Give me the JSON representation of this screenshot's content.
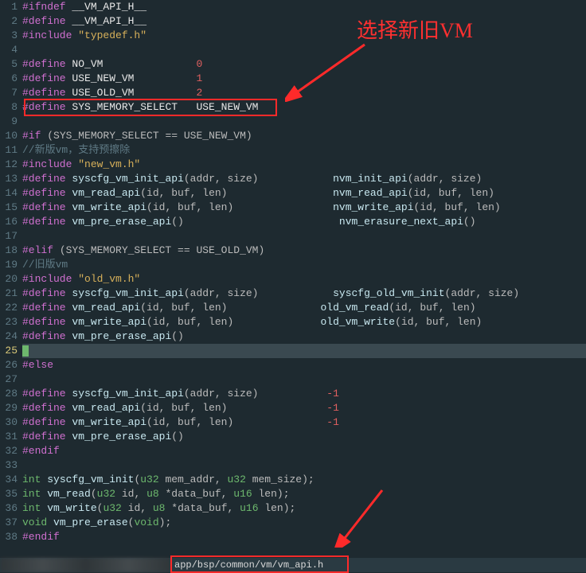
{
  "annotation_text": "选择新旧VM",
  "status_path": "app/bsp/common/vm/vm_api.h",
  "current_line": 25,
  "code": [
    {
      "n": 1,
      "t": [
        [
          "k-pp",
          "#ifndef "
        ],
        [
          "k-mac",
          "__VM_API_H__"
        ]
      ]
    },
    {
      "n": 2,
      "t": [
        [
          "k-pp",
          "#define "
        ],
        [
          "k-mac",
          "__VM_API_H__"
        ]
      ]
    },
    {
      "n": 3,
      "t": [
        [
          "k-pp",
          "#include "
        ],
        [
          "k-str",
          "\"typedef.h\""
        ]
      ]
    },
    {
      "n": 4,
      "t": []
    },
    {
      "n": 5,
      "t": [
        [
          "k-pp",
          "#define "
        ],
        [
          "k-mac",
          "NO_VM               "
        ],
        [
          "k-num",
          "0"
        ]
      ]
    },
    {
      "n": 6,
      "t": [
        [
          "k-pp",
          "#define "
        ],
        [
          "k-mac",
          "USE_NEW_VM          "
        ],
        [
          "k-num",
          "1"
        ]
      ]
    },
    {
      "n": 7,
      "t": [
        [
          "k-pp",
          "#define "
        ],
        [
          "k-mac",
          "USE_OLD_VM          "
        ],
        [
          "k-num",
          "2"
        ]
      ]
    },
    {
      "n": 8,
      "t": [
        [
          "k-pp",
          "#define "
        ],
        [
          "k-mac",
          "SYS_MEMORY_SELECT   USE_NEW_VM"
        ]
      ]
    },
    {
      "n": 9,
      "t": []
    },
    {
      "n": 10,
      "t": [
        [
          "k-pp",
          "#if "
        ],
        [
          "k-def",
          "(SYS_MEMORY_SELECT "
        ],
        [
          "k-def",
          "=="
        ],
        [
          "k-def",
          " USE_NEW_VM)"
        ]
      ]
    },
    {
      "n": 11,
      "t": [
        [
          "k-cmt",
          "//新版vm，支持预擦除"
        ]
      ]
    },
    {
      "n": 12,
      "t": [
        [
          "k-pp",
          "#include "
        ],
        [
          "k-str",
          "\"new_vm.h\""
        ]
      ]
    },
    {
      "n": 13,
      "t": [
        [
          "k-pp",
          "#define "
        ],
        [
          "k-fn",
          "syscfg_vm_init_api"
        ],
        [
          "k-def",
          "(addr, size)            "
        ],
        [
          "k-fn",
          "nvm_init_api"
        ],
        [
          "k-def",
          "(addr, size)"
        ]
      ]
    },
    {
      "n": 14,
      "t": [
        [
          "k-pp",
          "#define "
        ],
        [
          "k-fn",
          "vm_read_api"
        ],
        [
          "k-def",
          "(id, buf, len)                 "
        ],
        [
          "k-fn",
          "nvm_read_api"
        ],
        [
          "k-def",
          "(id, buf, len)"
        ]
      ]
    },
    {
      "n": 15,
      "t": [
        [
          "k-pp",
          "#define "
        ],
        [
          "k-fn",
          "vm_write_api"
        ],
        [
          "k-def",
          "(id, buf, len)                "
        ],
        [
          "k-fn",
          "nvm_write_api"
        ],
        [
          "k-def",
          "(id, buf, len)"
        ]
      ]
    },
    {
      "n": 16,
      "t": [
        [
          "k-pp",
          "#define "
        ],
        [
          "k-fn",
          "vm_pre_erase_api"
        ],
        [
          "k-def",
          "()                         "
        ],
        [
          "k-fn",
          "nvm_erasure_next_api"
        ],
        [
          "k-def",
          "()"
        ]
      ]
    },
    {
      "n": 17,
      "t": []
    },
    {
      "n": 18,
      "t": [
        [
          "k-pp",
          "#elif "
        ],
        [
          "k-def",
          "(SYS_MEMORY_SELECT "
        ],
        [
          "k-def",
          "=="
        ],
        [
          "k-def",
          " USE_OLD_VM)"
        ]
      ]
    },
    {
      "n": 19,
      "t": [
        [
          "k-cmt",
          "//旧版vm"
        ]
      ]
    },
    {
      "n": 20,
      "t": [
        [
          "k-pp",
          "#include "
        ],
        [
          "k-str",
          "\"old_vm.h\""
        ]
      ]
    },
    {
      "n": 21,
      "t": [
        [
          "k-pp",
          "#define "
        ],
        [
          "k-fn",
          "syscfg_vm_init_api"
        ],
        [
          "k-def",
          "(addr, size)            "
        ],
        [
          "k-fn",
          "syscfg_old_vm_init"
        ],
        [
          "k-def",
          "(addr, size)"
        ]
      ]
    },
    {
      "n": 22,
      "t": [
        [
          "k-pp",
          "#define "
        ],
        [
          "k-fn",
          "vm_read_api"
        ],
        [
          "k-def",
          "(id, buf, len)               "
        ],
        [
          "k-fn",
          "old_vm_read"
        ],
        [
          "k-def",
          "(id, buf, len)"
        ]
      ]
    },
    {
      "n": 23,
      "t": [
        [
          "k-pp",
          "#define "
        ],
        [
          "k-fn",
          "vm_write_api"
        ],
        [
          "k-def",
          "(id, buf, len)              "
        ],
        [
          "k-fn",
          "old_vm_write"
        ],
        [
          "k-def",
          "(id, buf, len)"
        ]
      ]
    },
    {
      "n": 24,
      "t": [
        [
          "k-pp",
          "#define "
        ],
        [
          "k-fn",
          "vm_pre_erase_api"
        ],
        [
          "k-def",
          "()"
        ]
      ]
    },
    {
      "n": 25,
      "t": []
    },
    {
      "n": 26,
      "t": [
        [
          "k-pp",
          "#else"
        ]
      ]
    },
    {
      "n": 27,
      "t": []
    },
    {
      "n": 28,
      "t": [
        [
          "k-pp",
          "#define "
        ],
        [
          "k-fn",
          "syscfg_vm_init_api"
        ],
        [
          "k-def",
          "(addr, size)           "
        ],
        [
          "k-num",
          "-1"
        ]
      ]
    },
    {
      "n": 29,
      "t": [
        [
          "k-pp",
          "#define "
        ],
        [
          "k-fn",
          "vm_read_api"
        ],
        [
          "k-def",
          "(id, buf, len)                "
        ],
        [
          "k-num",
          "-1"
        ]
      ]
    },
    {
      "n": 30,
      "t": [
        [
          "k-pp",
          "#define "
        ],
        [
          "k-fn",
          "vm_write_api"
        ],
        [
          "k-def",
          "(id, buf, len)               "
        ],
        [
          "k-num",
          "-1"
        ]
      ]
    },
    {
      "n": 31,
      "t": [
        [
          "k-pp",
          "#define "
        ],
        [
          "k-fn",
          "vm_pre_erase_api"
        ],
        [
          "k-def",
          "()"
        ]
      ]
    },
    {
      "n": 32,
      "t": [
        [
          "k-pp",
          "#endif"
        ]
      ]
    },
    {
      "n": 33,
      "t": []
    },
    {
      "n": 34,
      "t": [
        [
          "k-type",
          "int "
        ],
        [
          "k-fn",
          "syscfg_vm_init"
        ],
        [
          "k-def",
          "("
        ],
        [
          "k-type",
          "u32"
        ],
        [
          "k-def",
          " mem_addr, "
        ],
        [
          "k-type",
          "u32"
        ],
        [
          "k-def",
          " mem_size);"
        ]
      ]
    },
    {
      "n": 35,
      "t": [
        [
          "k-type",
          "int "
        ],
        [
          "k-fn",
          "vm_read"
        ],
        [
          "k-def",
          "("
        ],
        [
          "k-type",
          "u32"
        ],
        [
          "k-def",
          " id, "
        ],
        [
          "k-type",
          "u8"
        ],
        [
          "k-def",
          " *data_buf, "
        ],
        [
          "k-type",
          "u16"
        ],
        [
          "k-def",
          " len);"
        ]
      ]
    },
    {
      "n": 36,
      "t": [
        [
          "k-type",
          "int "
        ],
        [
          "k-fn",
          "vm_write"
        ],
        [
          "k-def",
          "("
        ],
        [
          "k-type",
          "u32"
        ],
        [
          "k-def",
          " id, "
        ],
        [
          "k-type",
          "u8"
        ],
        [
          "k-def",
          " *data_buf, "
        ],
        [
          "k-type",
          "u16"
        ],
        [
          "k-def",
          " len);"
        ]
      ]
    },
    {
      "n": 37,
      "t": [
        [
          "k-type",
          "void "
        ],
        [
          "k-fn",
          "vm_pre_erase"
        ],
        [
          "k-def",
          "("
        ],
        [
          "k-type",
          "void"
        ],
        [
          "k-def",
          ");"
        ]
      ]
    },
    {
      "n": 38,
      "t": [
        [
          "k-pp",
          "#endif"
        ]
      ]
    }
  ]
}
